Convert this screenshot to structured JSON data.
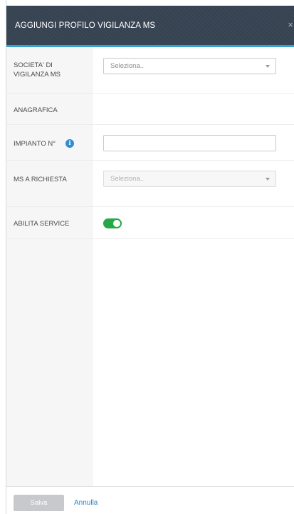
{
  "header": {
    "title": "AGGIUNGI PROFILO VIGILANZA MS",
    "close_glyph": "×"
  },
  "form": {
    "societa": {
      "label": "SOCIETA' DI VIGILANZA MS",
      "placeholder": "Seleziona.."
    },
    "anagrafica": {
      "label": "ANAGRAFICA"
    },
    "impianto": {
      "label": "IMPIANTO N°",
      "info_icon": "info-icon",
      "value": ""
    },
    "ms_richiesta": {
      "label": "MS A RICHIESTA",
      "placeholder": "Seleziona..",
      "disabled": true
    },
    "abilita_service": {
      "label": "ABILITA SERVICE",
      "enabled": true
    }
  },
  "footer": {
    "save_label": "Salva",
    "cancel_label": "Annulla"
  },
  "colors": {
    "header_bg": "#3a4756",
    "accent": "#35a3d1",
    "toggle_on": "#27a745",
    "link": "#2a86c7"
  }
}
